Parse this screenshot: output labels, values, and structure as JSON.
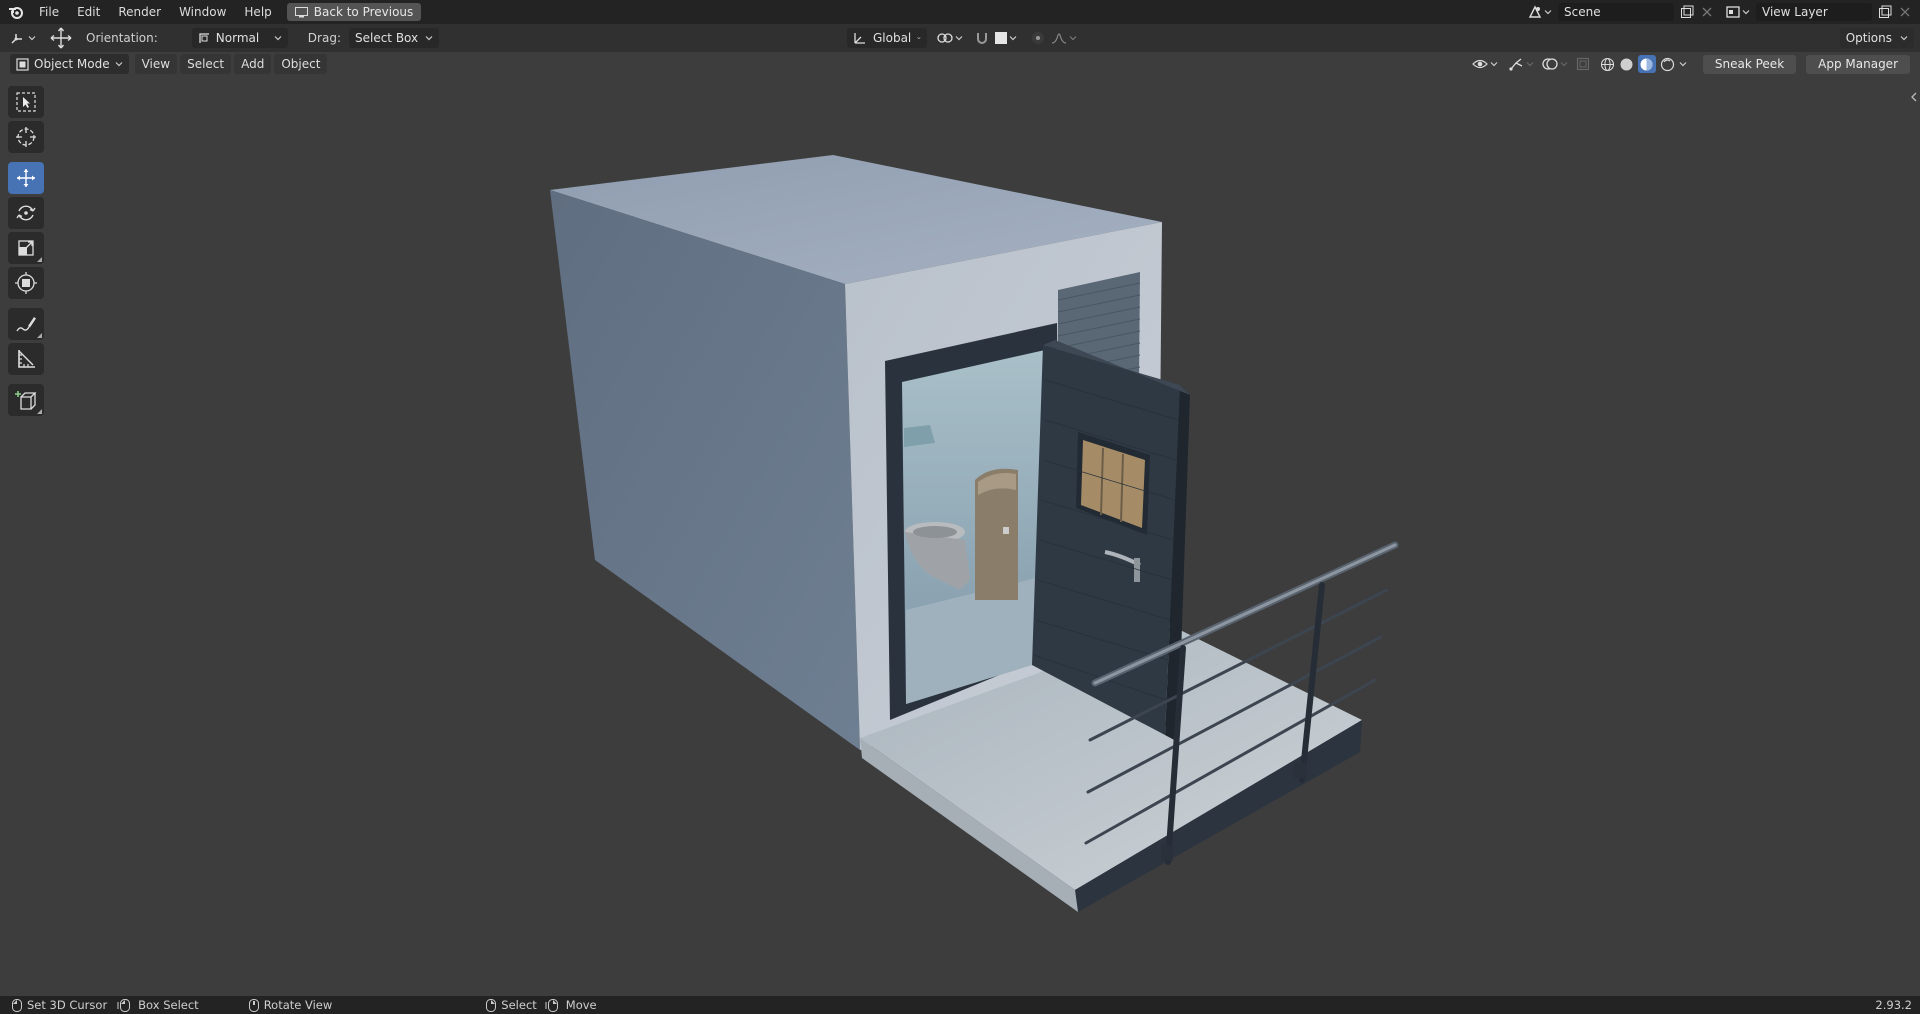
{
  "menu": {
    "items": [
      "File",
      "Edit",
      "Render",
      "Window",
      "Help"
    ],
    "back_button": "Back to Previous"
  },
  "scene": {
    "name": "Scene"
  },
  "view_layer": {
    "name": "View Layer"
  },
  "header": {
    "orientation_label": "Orientation:",
    "orientation_value": "Normal",
    "drag_label": "Drag:",
    "drag_value": "Select Box",
    "transform_orientation": "Global",
    "options_label": "Options"
  },
  "viewport_header": {
    "mode": "Object Mode",
    "menus": [
      "View",
      "Select",
      "Add",
      "Object"
    ],
    "sneak_peek": "Sneak Peek",
    "app_manager": "App Manager"
  },
  "tools": [
    {
      "name": "select-box-tool",
      "icon": "select-box-icon",
      "active": false
    },
    {
      "name": "cursor-tool",
      "icon": "cursor-icon",
      "active": false
    },
    {
      "name": "move-tool",
      "icon": "move-icon",
      "active": true
    },
    {
      "name": "rotate-tool",
      "icon": "rotate-icon",
      "active": false
    },
    {
      "name": "scale-tool",
      "icon": "scale-icon",
      "active": false
    },
    {
      "name": "transform-tool",
      "icon": "transform-icon",
      "active": false
    },
    {
      "name": "annotate-tool",
      "icon": "annotate-icon",
      "active": false
    },
    {
      "name": "measure-tool",
      "icon": "measure-icon",
      "active": false
    },
    {
      "name": "add-cube-tool",
      "icon": "add-cube-icon",
      "active": false
    }
  ],
  "status": {
    "set_cursor": "Set 3D Cursor",
    "box_select": "Box Select",
    "rotate_view": "Rotate View",
    "select": "Select",
    "move": "Move",
    "version": "2.93.2"
  },
  "colors": {
    "accent": "#4772b3",
    "viewport": "#3d3d3d",
    "topbar": "#232323"
  }
}
